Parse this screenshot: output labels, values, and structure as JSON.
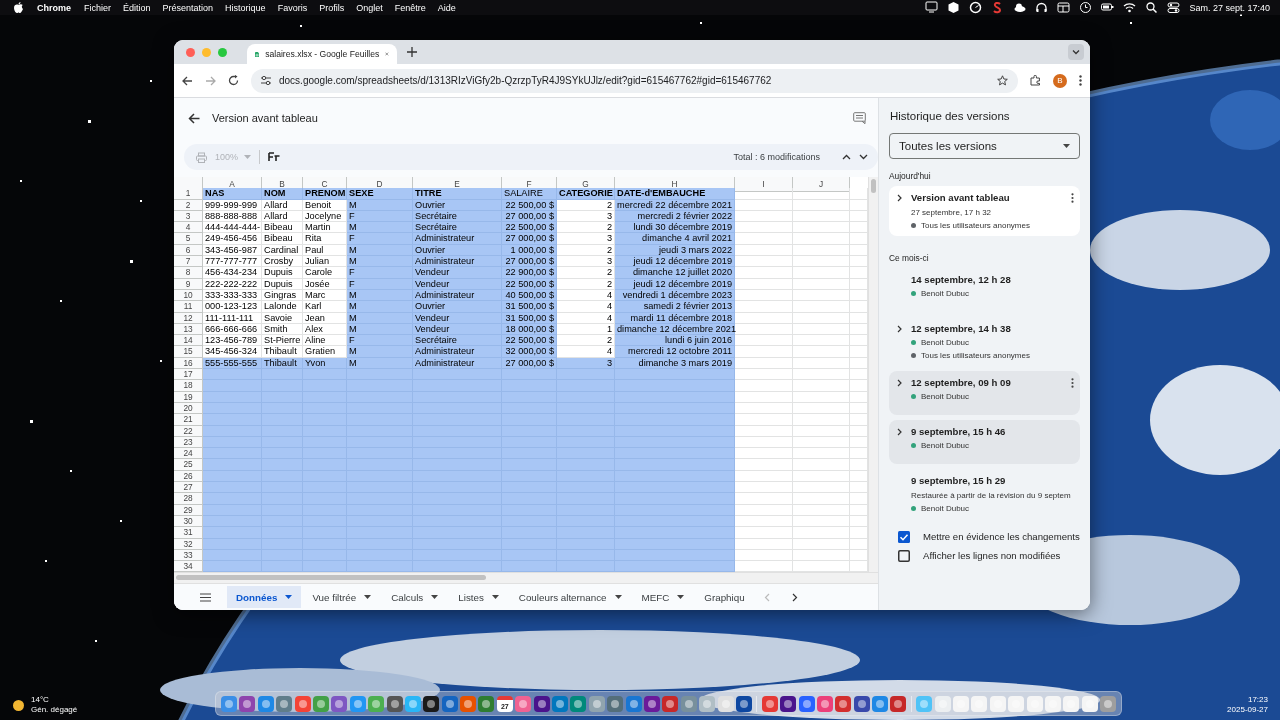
{
  "menubar": {
    "app": "Chrome",
    "menus": [
      "Fichier",
      "Édition",
      "Présentation",
      "Historique",
      "Favoris",
      "Profils",
      "Onglet",
      "Fenêtre",
      "Aide"
    ],
    "clock": "Sam. 27 sept. 17:40"
  },
  "browser": {
    "tab_title": "salaires.xlsx - Google Feuilles",
    "url": "docs.google.com/spreadsheets/d/1313RIzViGfy2b-QzrzpTyR4J9SYkUJlz/edit?gid=615467762#gid=615467762",
    "profile_initial": "B"
  },
  "doc": {
    "title": "Version avant tableau",
    "zoom": "100%",
    "total": "Total : 6 modifications"
  },
  "sheet": {
    "columns": [
      {
        "letter": "A",
        "kind": "text"
      },
      {
        "letter": "B",
        "kind": "text"
      },
      {
        "letter": "C",
        "kind": "text"
      },
      {
        "letter": "D",
        "kind": "text"
      },
      {
        "letter": "E",
        "kind": "text"
      },
      {
        "letter": "F",
        "kind": "number"
      },
      {
        "letter": "G",
        "kind": "number"
      },
      {
        "letter": "H",
        "kind": "number"
      },
      {
        "letter": "I",
        "kind": "empty"
      },
      {
        "letter": "J",
        "kind": "empty"
      }
    ],
    "header_row": {
      "number": "1",
      "cells": [
        {
          "text": "NAS",
          "bold": true,
          "changed": true
        },
        {
          "text": "NOM",
          "bold": true,
          "changed": true
        },
        {
          "text": "PRENOM",
          "bold": true,
          "changed": true
        },
        {
          "text": "SEXE",
          "bold": true,
          "changed": true
        },
        {
          "text": "TITRE",
          "bold": true,
          "changed": true
        },
        {
          "text": "SALAIRE",
          "bold": false,
          "changed": true
        },
        {
          "text": "CATEGORIE",
          "bold": true,
          "changed": true
        },
        {
          "text": "DATE-d'EMBAUCHE",
          "bold": true,
          "changed": true
        }
      ]
    },
    "rows": [
      {
        "number": "2",
        "cells": [
          {
            "text": "999-999-999",
            "changed": false
          },
          {
            "text": "Allard",
            "changed": false
          },
          {
            "text": "Benoit",
            "changed": false
          },
          {
            "text": "M",
            "changed": true
          },
          {
            "text": "Ouvrier",
            "changed": true
          },
          {
            "text": "22 500,00 $",
            "changed": true
          },
          {
            "text": "2",
            "changed": false
          },
          {
            "text": "mercredi 22 décembre 2021",
            "changed": true
          }
        ]
      },
      {
        "number": "3",
        "cells": [
          {
            "text": "888-888-888",
            "changed": false
          },
          {
            "text": "Allard",
            "changed": false
          },
          {
            "text": "Jocelyne",
            "changed": false
          },
          {
            "text": "F",
            "changed": true
          },
          {
            "text": "Secrétaire",
            "changed": true
          },
          {
            "text": "27 000,00 $",
            "changed": true
          },
          {
            "text": "3",
            "changed": false
          },
          {
            "text": "mercredi 2 février 2022",
            "changed": true
          }
        ]
      },
      {
        "number": "4",
        "cells": [
          {
            "text": "444-444-444-",
            "changed": false
          },
          {
            "text": "Bibeau",
            "changed": false
          },
          {
            "text": "Martin",
            "changed": false
          },
          {
            "text": "M",
            "changed": true
          },
          {
            "text": "Secrétaire",
            "changed": true
          },
          {
            "text": "22 500,00 $",
            "changed": true
          },
          {
            "text": "2",
            "changed": false
          },
          {
            "text": "lundi 30 décembre 2019",
            "changed": true
          }
        ]
      },
      {
        "number": "5",
        "cells": [
          {
            "text": "249-456-456",
            "changed": false
          },
          {
            "text": "Bibeau",
            "changed": false
          },
          {
            "text": "Rita",
            "changed": false
          },
          {
            "text": "F",
            "changed": true
          },
          {
            "text": "Administrateur",
            "changed": true
          },
          {
            "text": "27 000,00 $",
            "changed": true
          },
          {
            "text": "3",
            "changed": false
          },
          {
            "text": "dimanche 4 avril 2021",
            "changed": true
          }
        ]
      },
      {
        "number": "6",
        "cells": [
          {
            "text": "343-456-987",
            "changed": false
          },
          {
            "text": "Cardinal",
            "changed": false
          },
          {
            "text": "Paul",
            "changed": false
          },
          {
            "text": "M",
            "changed": true
          },
          {
            "text": "Ouvrier",
            "changed": true
          },
          {
            "text": "1 000,00 $",
            "changed": true
          },
          {
            "text": "2",
            "changed": false
          },
          {
            "text": "jeudi 3 mars 2022",
            "changed": true
          }
        ]
      },
      {
        "number": "7",
        "cells": [
          {
            "text": "777-777-777",
            "changed": false
          },
          {
            "text": "Crosby",
            "changed": false
          },
          {
            "text": "Julian",
            "changed": false
          },
          {
            "text": "M",
            "changed": true
          },
          {
            "text": "Administrateur",
            "changed": true
          },
          {
            "text": "27 000,00 $",
            "changed": true
          },
          {
            "text": "3",
            "changed": false
          },
          {
            "text": "jeudi 12 décembre 2019",
            "changed": true
          }
        ]
      },
      {
        "number": "8",
        "cells": [
          {
            "text": "456-434-234",
            "changed": false
          },
          {
            "text": "Dupuis",
            "changed": false
          },
          {
            "text": "Carole",
            "changed": false
          },
          {
            "text": "F",
            "changed": true
          },
          {
            "text": "Vendeur",
            "changed": true
          },
          {
            "text": "22 900,00 $",
            "changed": true
          },
          {
            "text": "2",
            "changed": false
          },
          {
            "text": "dimanche 12 juillet 2020",
            "changed": true
          }
        ]
      },
      {
        "number": "9",
        "cells": [
          {
            "text": "222-222-222",
            "changed": false
          },
          {
            "text": "Dupuis",
            "changed": false
          },
          {
            "text": "Josée",
            "changed": false
          },
          {
            "text": "F",
            "changed": true
          },
          {
            "text": "Vendeur",
            "changed": true
          },
          {
            "text": "22 500,00 $",
            "changed": true
          },
          {
            "text": "2",
            "changed": false
          },
          {
            "text": "jeudi 12 décembre 2019",
            "changed": true
          }
        ]
      },
      {
        "number": "10",
        "cells": [
          {
            "text": "333-333-333",
            "changed": false
          },
          {
            "text": "Gingras",
            "changed": false
          },
          {
            "text": "Marc",
            "changed": false
          },
          {
            "text": "M",
            "changed": true
          },
          {
            "text": "Administrateur",
            "changed": true
          },
          {
            "text": "40 500,00 $",
            "changed": true
          },
          {
            "text": "4",
            "changed": false
          },
          {
            "text": "vendredi 1 décembre 2023",
            "changed": true
          }
        ]
      },
      {
        "number": "11",
        "cells": [
          {
            "text": "000-123-123",
            "changed": false
          },
          {
            "text": "Lalonde",
            "changed": false
          },
          {
            "text": "Karl",
            "changed": false
          },
          {
            "text": "M",
            "changed": true
          },
          {
            "text": "Ouvrier",
            "changed": true
          },
          {
            "text": "31 500,00 $",
            "changed": true
          },
          {
            "text": "4",
            "changed": false
          },
          {
            "text": "samedi 2 février 2013",
            "changed": true
          }
        ]
      },
      {
        "number": "12",
        "cells": [
          {
            "text": "111-111-111",
            "changed": false
          },
          {
            "text": "Savoie",
            "changed": false
          },
          {
            "text": "Jean",
            "changed": false
          },
          {
            "text": "M",
            "changed": true
          },
          {
            "text": "Vendeur",
            "changed": true
          },
          {
            "text": "31 500,00 $",
            "changed": true
          },
          {
            "text": "4",
            "changed": false
          },
          {
            "text": "mardi 11 décembre 2018",
            "changed": true
          }
        ]
      },
      {
        "number": "13",
        "cells": [
          {
            "text": "666-666-666",
            "changed": false
          },
          {
            "text": "Smith",
            "changed": false
          },
          {
            "text": "Alex",
            "changed": false
          },
          {
            "text": "M",
            "changed": true
          },
          {
            "text": "Vendeur",
            "changed": true
          },
          {
            "text": "18 000,00 $",
            "changed": true
          },
          {
            "text": "1",
            "changed": false
          },
          {
            "text": "dimanche 12 décembre 2021",
            "changed": true
          }
        ]
      },
      {
        "number": "14",
        "cells": [
          {
            "text": "123-456-789",
            "changed": false
          },
          {
            "text": "St-Pierre",
            "changed": false
          },
          {
            "text": "Aline",
            "changed": false
          },
          {
            "text": "F",
            "changed": true
          },
          {
            "text": "Secrétaire",
            "changed": true
          },
          {
            "text": "22 500,00 $",
            "changed": true
          },
          {
            "text": "2",
            "changed": false
          },
          {
            "text": "lundi 6 juin 2016",
            "changed": true
          }
        ]
      },
      {
        "number": "15",
        "cells": [
          {
            "text": "345-456-324",
            "changed": false
          },
          {
            "text": "Thibault",
            "changed": false
          },
          {
            "text": "Gratien",
            "changed": false
          },
          {
            "text": "M",
            "changed": true
          },
          {
            "text": "Administrateur",
            "changed": true
          },
          {
            "text": "32 000,00 $",
            "changed": true
          },
          {
            "text": "4",
            "changed": false
          },
          {
            "text": "mercredi 12 octobre 2011",
            "changed": true
          }
        ]
      },
      {
        "number": "16",
        "cells": [
          {
            "text": "555-555-555",
            "changed": true
          },
          {
            "text": "Thibault",
            "changed": true
          },
          {
            "text": "Yvon",
            "changed": true
          },
          {
            "text": "M",
            "changed": true
          },
          {
            "text": "Administrateur",
            "changed": true
          },
          {
            "text": "27 000,00 $",
            "changed": true
          },
          {
            "text": "3",
            "changed": true
          },
          {
            "text": "dimanche 3 mars 2019",
            "changed": true
          }
        ]
      },
      {
        "number": "17",
        "changed": true
      },
      {
        "number": "18",
        "changed": true
      },
      {
        "number": "19",
        "changed": true
      },
      {
        "number": "20",
        "changed": true
      },
      {
        "number": "21",
        "changed": true
      },
      {
        "number": "22",
        "changed": true
      },
      {
        "number": "23",
        "changed": true
      },
      {
        "number": "24",
        "changed": true
      },
      {
        "number": "25",
        "changed": true
      },
      {
        "number": "26",
        "changed": true
      },
      {
        "number": "27",
        "changed": true
      },
      {
        "number": "28",
        "changed": true
      },
      {
        "number": "29",
        "changed": true
      },
      {
        "number": "30",
        "changed": true
      },
      {
        "number": "31",
        "changed": true
      },
      {
        "number": "32",
        "changed": true
      },
      {
        "number": "33",
        "changed": true
      },
      {
        "number": "34",
        "changed": true
      }
    ]
  },
  "sheet_tabs": [
    {
      "label": "Données",
      "selected": true,
      "caret": true
    },
    {
      "label": "Vue filtrée",
      "selected": false,
      "caret": true
    },
    {
      "label": "Calculs",
      "selected": false,
      "caret": true
    },
    {
      "label": "Listes",
      "selected": false,
      "caret": true
    },
    {
      "label": "Couleurs alternance",
      "selected": false,
      "caret": true
    },
    {
      "label": "MEFC",
      "selected": false,
      "caret": true
    },
    {
      "label": "Graphiqu",
      "selected": false,
      "caret": false
    }
  ],
  "versions_panel": {
    "title": "Historique des versions",
    "filter": "Toutes les versions",
    "groups": [
      {
        "label": "Aujourd'hui",
        "items": [
          {
            "title": "Version avant tableau",
            "subtitle": "27 septembre, 17 h 32",
            "expandable": true,
            "selected": true,
            "hovered": false,
            "menu": true,
            "authors": [
              {
                "name": "Tous les utilisateurs anonymes",
                "color": "#5f6368"
              }
            ]
          }
        ]
      },
      {
        "label": "Ce mois-ci",
        "items": [
          {
            "title": "14 septembre, 12 h 28",
            "expandable": false,
            "selected": false,
            "hovered": false,
            "menu": false,
            "authors": [
              {
                "name": "Benoit Dubuc",
                "color": "#33a37c"
              }
            ]
          },
          {
            "title": "12 septembre, 14 h 38",
            "expandable": true,
            "selected": false,
            "hovered": false,
            "menu": false,
            "authors": [
              {
                "name": "Benoit Dubuc",
                "color": "#33a37c"
              },
              {
                "name": "Tous les utilisateurs anonymes",
                "color": "#5f6368"
              }
            ]
          },
          {
            "title": "12 septembre, 09 h 09",
            "expandable": true,
            "selected": false,
            "hovered": true,
            "menu": true,
            "authors": [
              {
                "name": "Benoit Dubuc",
                "color": "#33a37c"
              }
            ]
          },
          {
            "title": "9 septembre, 15 h 46",
            "expandable": true,
            "selected": false,
            "hovered": true,
            "menu": false,
            "authors": [
              {
                "name": "Benoit Dubuc",
                "color": "#33a37c"
              }
            ]
          },
          {
            "title": "9 septembre, 15 h 29",
            "note": "Restaurée à partir de la révision du 9 septem",
            "expandable": false,
            "selected": false,
            "hovered": false,
            "menu": false,
            "authors": [
              {
                "name": "Benoit Dubuc",
                "color": "#33a37c"
              }
            ]
          }
        ]
      }
    ],
    "options": [
      {
        "label": "Mettre en évidence les changements",
        "checked": true
      },
      {
        "label": "Afficher les lignes non modifiées",
        "checked": false
      }
    ]
  },
  "weather": {
    "temperature": "14°C",
    "condition": "Gén. dégagé"
  },
  "clock": {
    "time": "17:23",
    "date": "2025-09-27"
  },
  "dock": {
    "calendar_day": "27"
  }
}
